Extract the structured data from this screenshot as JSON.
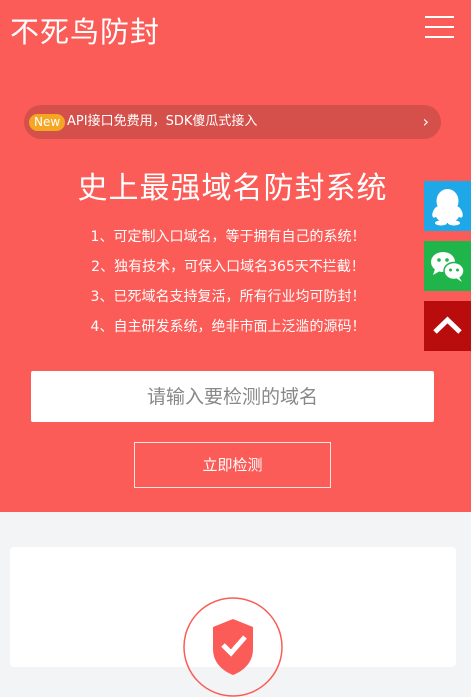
{
  "header": {
    "logo_text": "不死鸟防封"
  },
  "announcement": {
    "badge": "New",
    "text": "API接口免费用，SDK傻瓜式接入",
    "chevron": "›"
  },
  "hero": {
    "headline": "史上最强域名防封系统",
    "features": [
      "1、可定制入口域名，等于拥有自己的系统！",
      "2、独有技术，可保入口域名365天不拦截！",
      "3、已死域名支持复活，所有行业均可防封！",
      "4、自主研发系统，绝非市面上泛滥的源码！"
    ]
  },
  "search": {
    "placeholder": "请输入要检测的域名",
    "value": ""
  },
  "check_button": {
    "label": "立即检测"
  },
  "side_buttons": {
    "qq_icon": "qq-penguin-icon",
    "wechat_icon": "wechat-icon",
    "top_icon": "chevron-up-icon"
  },
  "colors": {
    "hero_bg": "#fb5c57",
    "qq": "#1ea8e7",
    "wechat": "#1fb54a",
    "back_to_top": "#b90d0d",
    "badge": "#f5a623"
  }
}
